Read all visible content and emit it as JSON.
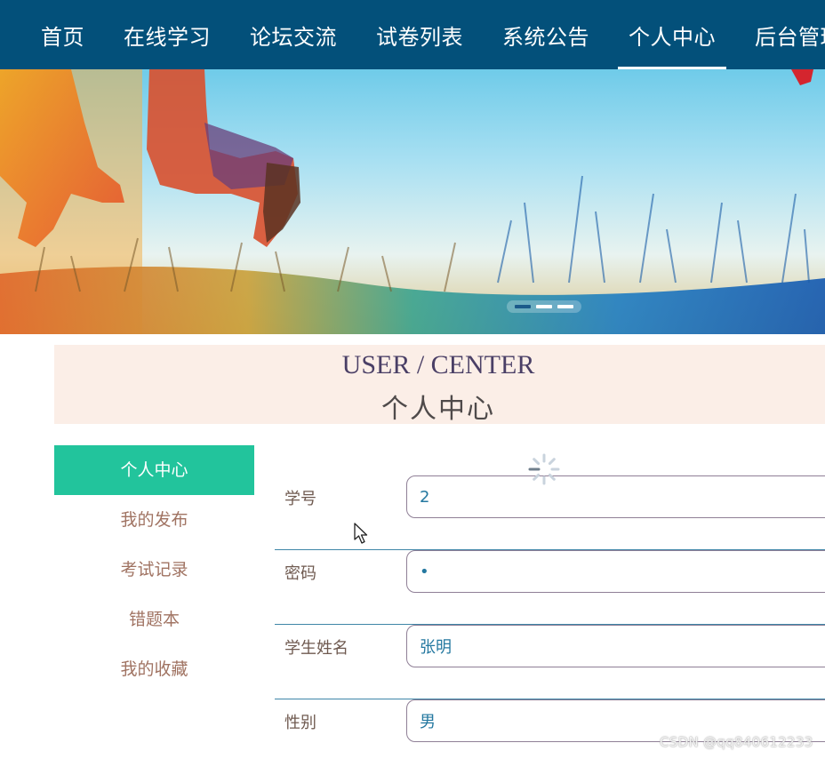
{
  "nav": {
    "items": [
      {
        "label": "首页",
        "active": false
      },
      {
        "label": "在线学习",
        "active": false
      },
      {
        "label": "论坛交流",
        "active": false
      },
      {
        "label": "试卷列表",
        "active": false
      },
      {
        "label": "系统公告",
        "active": false
      },
      {
        "label": "个人中心",
        "active": true
      },
      {
        "label": "后台管理",
        "active": false
      }
    ]
  },
  "banner": {
    "slide_count": 3,
    "active_slide": 1
  },
  "title": {
    "en": "USER / CENTER",
    "cn": "个人中心"
  },
  "side_menu": {
    "items": [
      {
        "label": "个人中心",
        "active": true
      },
      {
        "label": "我的发布",
        "active": false
      },
      {
        "label": "考试记录",
        "active": false
      },
      {
        "label": "错题本",
        "active": false
      },
      {
        "label": "我的收藏",
        "active": false
      }
    ]
  },
  "form": {
    "fields": [
      {
        "label": "学号",
        "value": "2",
        "type": "text"
      },
      {
        "label": "密码",
        "value": "•",
        "type": "text"
      },
      {
        "label": "学生姓名",
        "value": "张明",
        "type": "text"
      },
      {
        "label": "性别",
        "value": "男",
        "type": "text"
      }
    ]
  },
  "watermark": "CSDN @qq840612233",
  "colors": {
    "nav_bg": "#03507a",
    "side_active_bg": "#22c49c",
    "title_band_bg": "#fbeee7",
    "input_text": "#2478a0"
  }
}
